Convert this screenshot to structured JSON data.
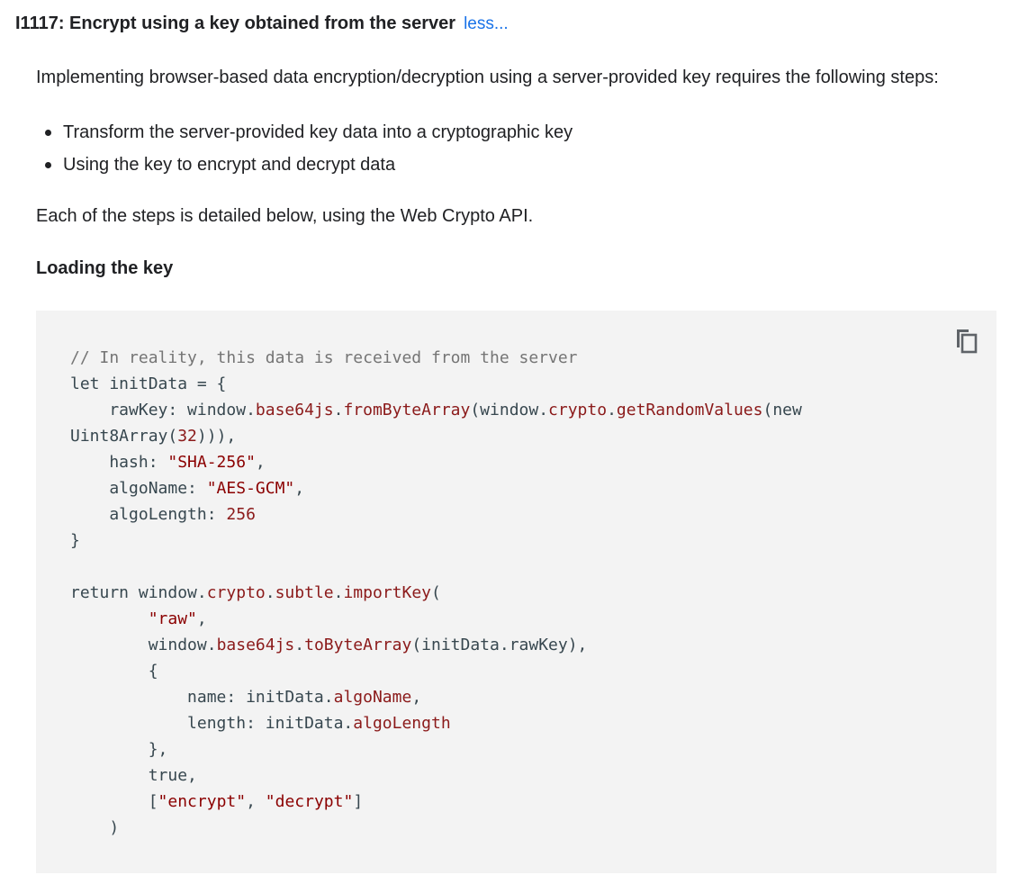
{
  "issue": {
    "title": "I1117: Encrypt using a key obtained from the server",
    "toggle_label": "less..."
  },
  "intro": "Implementing browser-based data encryption/decryption using a server-provided key requires the following steps:",
  "bullets": [
    "Transform the server-provided key data into a cryptographic key",
    "Using the key to encrypt and decrypt data"
  ],
  "steps_note": "Each of the steps is detailed below, using the Web Crypto API.",
  "section_heading": "Loading the key",
  "code": {
    "comment": "// In reality, this data is received from the server",
    "copy_icon": "copy-icon",
    "lines": {
      "l2a": "let initData = {",
      "l3a": "    rawKey: window.",
      "l3b": "base64js",
      "l3c": ".",
      "l3d": "fromByteArray",
      "l3e": "(window.",
      "l3f": "crypto",
      "l3g": ".",
      "l3h": "getRandomValues",
      "l3i": "(new",
      "l4a": "Uint8Array(",
      "l4b": "32",
      "l4c": "))),",
      "l5a": "    hash: ",
      "l5b": "\"SHA-256\"",
      "l5c": ",",
      "l6a": "    algoName: ",
      "l6b": "\"AES-GCM\"",
      "l6c": ",",
      "l7a": "    algoLength: ",
      "l7b": "256",
      "l8a": "}",
      "l10a": "return window.",
      "l10b": "crypto",
      "l10c": ".",
      "l10d": "subtle",
      "l10e": ".",
      "l10f": "importKey",
      "l10g": "(",
      "l11a": "        ",
      "l11b": "\"raw\"",
      "l11c": ",",
      "l12a": "        window.",
      "l12b": "base64js",
      "l12c": ".",
      "l12d": "toByteArray",
      "l12e": "(initData.rawKey),",
      "l13a": "        {",
      "l14a": "            name: initData.",
      "l14b": "algoName",
      "l14c": ",",
      "l15a": "            length: initData.",
      "l15b": "algoLength",
      "l16a": "        },",
      "l17a": "        true,",
      "l18a": "        [",
      "l18b": "\"encrypt\"",
      "l18c": ", ",
      "l18d": "\"decrypt\"",
      "l18e": "]",
      "l19a": "    )"
    }
  }
}
